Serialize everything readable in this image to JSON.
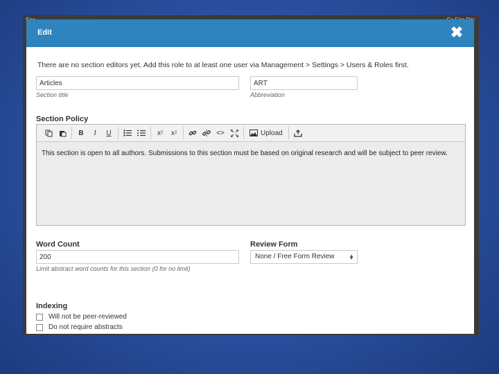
{
  "backdrop": {
    "left_text": "Sec...",
    "right_text": "Cx  Fire Dry"
  },
  "modal": {
    "title": "Edit",
    "close_glyph": "✖"
  },
  "notice": "There are no section editors yet. Add this role to at least one user via Management > Settings > Users & Roles first.",
  "section_title": {
    "value": "Articles",
    "help": "Section title"
  },
  "abbreviation": {
    "value": "ART",
    "help": "Abbreviation"
  },
  "section_policy": {
    "label": "Section Policy",
    "toolbar": {
      "upload_label": "Upload"
    },
    "content": "This section is open to all authors. Submissions to this section must be based on original research and will be subject to peer review."
  },
  "word_count": {
    "label": "Word Count",
    "value": "200",
    "help": "Limit abstract word counts for this section (0 for no limit)"
  },
  "review_form": {
    "label": "Review Form",
    "selected": "None / Free Form Review"
  },
  "indexing": {
    "label": "Indexing",
    "options": [
      {
        "label": "Will not be peer-reviewed",
        "checked": false
      },
      {
        "label": "Do not require abstracts",
        "checked": false
      }
    ]
  },
  "colors": {
    "header": "#2f84bf",
    "slide_background": "#2a4f9e"
  }
}
